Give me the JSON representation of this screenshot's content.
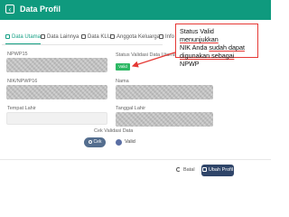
{
  "header": {
    "back_icon": "back-icon",
    "title": "Data Profil",
    "bg_color": "#0f9a7e"
  },
  "tabs": [
    {
      "label": "Data Utama",
      "icon": "id-card-icon",
      "active": true
    },
    {
      "label": "Data Lainnya",
      "icon": "document-icon",
      "active": false
    },
    {
      "label": "Data KLU",
      "icon": "briefcase-icon",
      "active": false
    },
    {
      "label": "Anggota Keluarga",
      "icon": "family-icon",
      "active": false
    },
    {
      "label": "Info",
      "icon": "info-icon",
      "active": false
    }
  ],
  "form": {
    "npwp_label": "NPWP15",
    "nik_label": "NIK/NPWP16",
    "tempat_lahir_label": "Tempat Lahir",
    "status_validasi_label": "Status Validasi Data Utama",
    "status_badge": "Valid",
    "nama_label": "Nama",
    "tanggal_lahir_label": "Tanggal Lahir",
    "cek_validasi_label": "Cek Validasi Data",
    "cek_button": "Cek",
    "valid_status": "Valid"
  },
  "footer": {
    "batal": "Batal",
    "ubah_profil": "Ubah Profil"
  },
  "annotation": {
    "line1": "Status Valid",
    "line1b": "menunjukkan",
    "line2": "NIK Anda",
    "line2b": "sudah dapat",
    "line3": "digunakan sebagai",
    "line3b": "NPWP",
    "border_color": "#e53935"
  }
}
